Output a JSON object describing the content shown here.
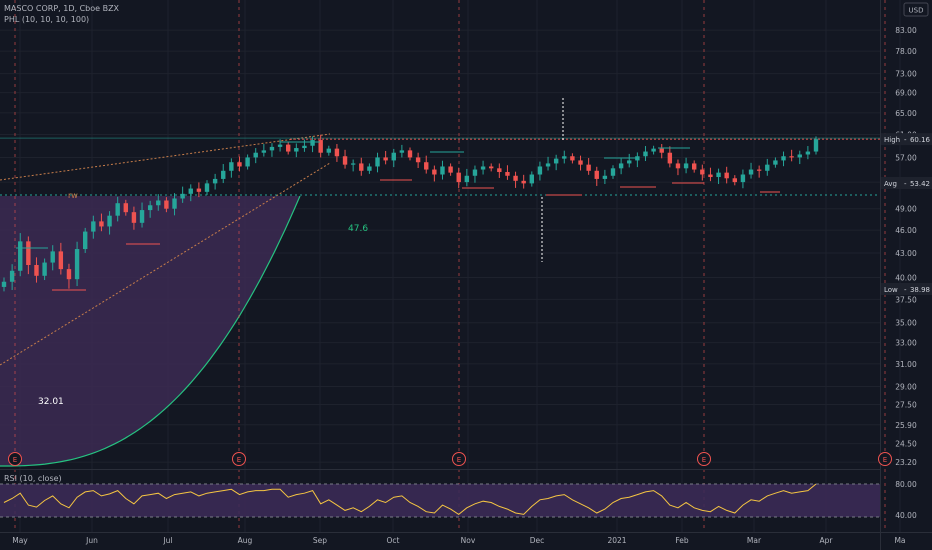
{
  "header": {
    "symbol_line": "MASCO CORP, 1D, Cboe BZX",
    "indicator_line": "PHL (10, 10, 10, 100)"
  },
  "currency_button": "USD",
  "colors": {
    "background": "#131722",
    "grid": "#1e222d",
    "up": "#26a69a",
    "down": "#ef5350",
    "rsi_line": "#f5c542",
    "rsi_band": "#3b2a55",
    "area_fill": "#3c2a52",
    "curve": "#26c281",
    "high_line": "#ef5350",
    "avg_line": "#26a69a",
    "trend_line": "#c77d4a",
    "text": "#b2b5be"
  },
  "chart_data": [
    {
      "type": "candlestick",
      "y_axis_ticks": [
        83.0,
        78.0,
        73.0,
        69.0,
        65.0,
        61.0,
        57.0,
        53.0,
        49.0,
        46.0,
        43.0,
        40.0,
        37.5,
        35.0,
        33.0,
        31.0,
        29.0,
        27.5,
        25.9,
        24.5,
        23.2
      ],
      "y_scale": "log",
      "x_axis_ticks": [
        "May",
        "Jun",
        "Jul",
        "Aug",
        "Sep",
        "Oct",
        "Nov",
        "Dec",
        "2021",
        "Feb",
        "Mar",
        "Apr",
        "Ma"
      ],
      "price_labels": [
        {
          "name": "High",
          "value": 60.16
        },
        {
          "name": "Avg",
          "value": 53.42
        },
        {
          "name": "Low",
          "value": 38.98
        }
      ],
      "annotations": [
        "47.6",
        "32.01",
        "rw"
      ],
      "earnings_markers": [
        "E",
        "E",
        "E",
        "E",
        "E"
      ],
      "close_series": [
        39.5,
        40.8,
        44.5,
        41.5,
        40.2,
        41.8,
        43.2,
        41.0,
        39.8,
        43.5,
        45.8,
        47.2,
        46.5,
        48.0,
        49.8,
        48.5,
        47.0,
        48.8,
        49.5,
        50.2,
        49.0,
        50.5,
        51.2,
        52.0,
        51.5,
        52.8,
        53.5,
        54.8,
        56.2,
        55.5,
        57.0,
        57.8,
        58.2,
        58.8,
        59.2,
        58.0,
        58.6,
        59.0,
        60.0,
        57.8,
        58.5,
        57.2,
        55.8,
        56.0,
        54.8,
        55.5,
        57.0,
        56.5,
        57.8,
        58.2,
        57.0,
        56.2,
        55.0,
        54.2,
        55.5,
        54.5,
        53.0,
        54.0,
        55.0,
        55.5,
        55.2,
        54.6,
        54.0,
        53.2,
        52.8,
        54.2,
        55.5,
        56.0,
        56.8,
        57.2,
        56.5,
        55.8,
        54.8,
        53.5,
        54.0,
        55.2,
        56.0,
        56.5,
        57.2,
        58.0,
        58.5,
        57.8,
        56.0,
        55.2,
        56.0,
        55.0,
        54.2,
        53.8,
        54.5,
        53.6,
        53.0,
        54.2,
        55.0,
        54.8,
        55.8,
        56.5,
        57.2,
        57.0,
        57.5,
        58.0,
        60.16
      ]
    },
    {
      "type": "line",
      "title": "RSI (10, close)",
      "y_axis_ticks": [
        80.0,
        40.0
      ],
      "band_levels": [
        80,
        30
      ],
      "values": [
        52,
        58,
        66,
        48,
        45,
        55,
        62,
        50,
        44,
        60,
        68,
        70,
        62,
        65,
        70,
        58,
        50,
        62,
        64,
        66,
        58,
        64,
        66,
        68,
        62,
        66,
        68,
        70,
        72,
        64,
        68,
        70,
        70,
        72,
        72,
        60,
        64,
        66,
        70,
        50,
        56,
        48,
        40,
        44,
        38,
        46,
        56,
        52,
        60,
        62,
        52,
        46,
        38,
        36,
        48,
        42,
        34,
        44,
        50,
        54,
        52,
        46,
        42,
        36,
        34,
        46,
        56,
        58,
        62,
        64,
        56,
        50,
        44,
        36,
        42,
        52,
        58,
        60,
        64,
        68,
        70,
        62,
        48,
        44,
        52,
        44,
        40,
        38,
        46,
        40,
        36,
        48,
        56,
        54,
        62,
        66,
        70,
        66,
        68,
        70,
        80
      ]
    }
  ]
}
